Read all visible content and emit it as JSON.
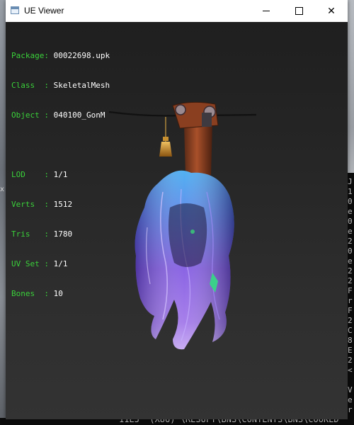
{
  "window": {
    "title": "UE Viewer"
  },
  "titlebar": {
    "minimize_icon": "minimize-icon",
    "maximize_icon": "maximize-icon",
    "close_icon": "close-icon",
    "close_glyph": "✕"
  },
  "info": {
    "object_rows": [
      {
        "key": "Package",
        "sep": ": ",
        "value": "00022698.upk"
      },
      {
        "key": "Class  ",
        "sep": ": ",
        "value": "SkeletalMesh"
      },
      {
        "key": "Object ",
        "sep": ": ",
        "value": "040100_GonM"
      }
    ],
    "mesh_rows": [
      {
        "key": "LOD    ",
        "sep": ": ",
        "value": "1/1"
      },
      {
        "key": "Verts  ",
        "sep": ": ",
        "value": "1512"
      },
      {
        "key": "Tris   ",
        "sep": ": ",
        "value": "1780"
      },
      {
        "key": "UV Set ",
        "sep": ": ",
        "value": "1/1"
      },
      {
        "key": "Bones  ",
        "sep": ": ",
        "value": "10"
      }
    ]
  },
  "background": {
    "console_lines": [
      "J",
      "1",
      "0",
      "e",
      "0",
      "e",
      "2",
      "0",
      "e",
      "2",
      "2",
      "F",
      "r",
      "F",
      "2",
      "C",
      "8",
      "E",
      "2",
      "<",
      "",
      "V",
      "e",
      "r",
      "n"
    ],
    "bottom_text": "11E5  (X86) \\RESUFT\\BNS\\CONTENTS\\BNS\\COOKED",
    "marker": "x",
    "colors": {
      "key_text": "#3ad13a",
      "value_text": "#ffffff"
    }
  }
}
